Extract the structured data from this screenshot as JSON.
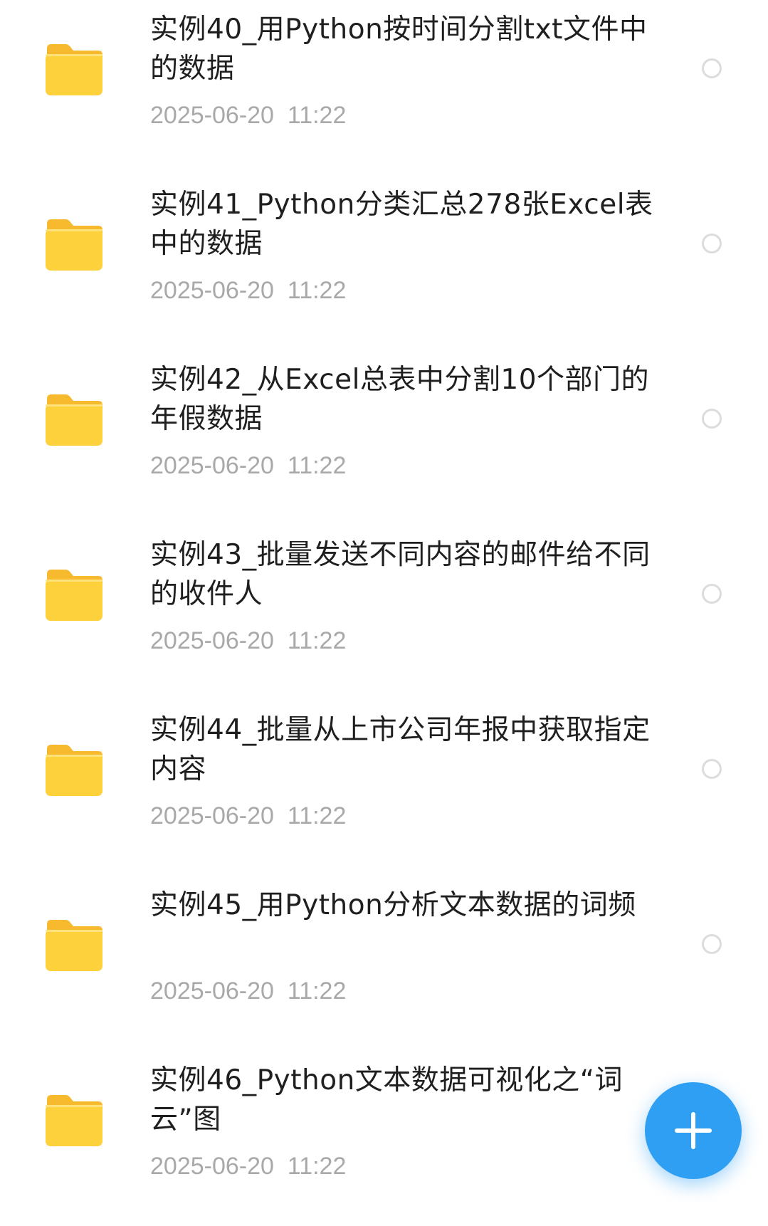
{
  "files": [
    {
      "name": "实例40_用Python按时间分割txt文件中的数据",
      "modified": "2025-06-20  11:22",
      "icon": "folder-icon",
      "selected": false
    },
    {
      "name": "实例41_Python分类汇总278张Excel表中的数据",
      "modified": "2025-06-20  11:22",
      "icon": "folder-icon",
      "selected": false
    },
    {
      "name": "实例42_从Excel总表中分割10个部门的年假数据",
      "modified": "2025-06-20  11:22",
      "icon": "folder-icon",
      "selected": false
    },
    {
      "name": "实例43_批量发送不同内容的邮件给不同的收件人",
      "modified": "2025-06-20  11:22",
      "icon": "folder-icon",
      "selected": false
    },
    {
      "name": "实例44_批量从上市公司年报中获取指定内容",
      "modified": "2025-06-20  11:22",
      "icon": "folder-icon",
      "selected": false
    },
    {
      "name": "实例45_用Python分析文本数据的词频",
      "modified": "2025-06-20  11:22",
      "icon": "folder-icon",
      "selected": false
    },
    {
      "name": "实例46_Python文本数据可视化之“词云”图",
      "modified": "2025-06-20  11:22",
      "icon": "folder-icon",
      "selected": false
    }
  ],
  "fab": {
    "icon": "plus-icon",
    "color": "#2f9ff3"
  },
  "colors": {
    "folder_front": "#fdd13b",
    "folder_back": "#f7b92e",
    "title_text": "#1f1f1f",
    "meta_text": "#a9a9a9"
  }
}
